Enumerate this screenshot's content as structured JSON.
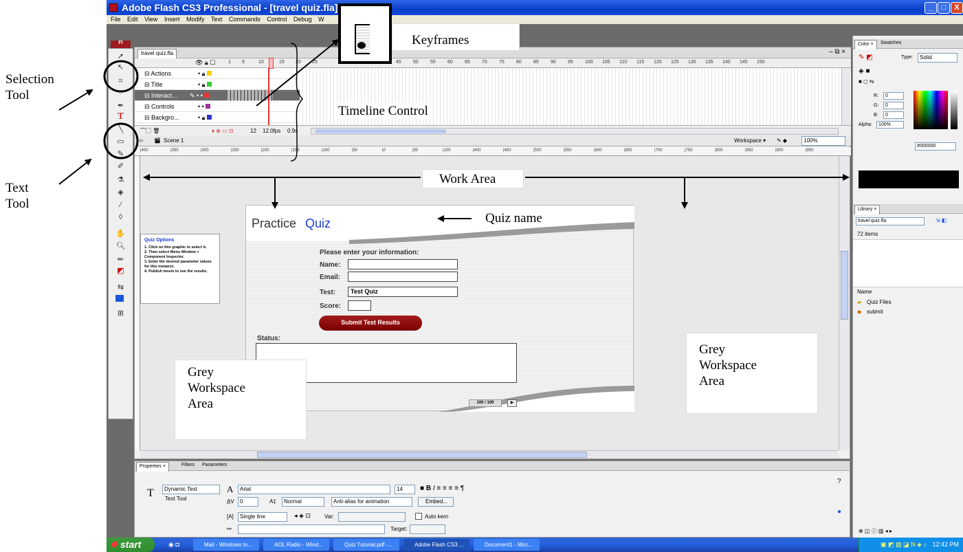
{
  "window": {
    "title": "Adobe Flash CS3 Professional - [travel quiz.fla]",
    "minimize": "_",
    "maximize": "□",
    "close": "X"
  },
  "menu": [
    "File",
    "Edit",
    "View",
    "Insert",
    "Modify",
    "Text",
    "Commands",
    "Control",
    "Debug",
    "W"
  ],
  "document": {
    "tab": "travel quiz.fla",
    "scene": "Scene 1",
    "workspace": "Workspace ▾",
    "zoom": "100%"
  },
  "timeline": {
    "frame_numbers": [
      "1",
      "5",
      "10",
      "15",
      "20",
      "25",
      "45",
      "50",
      "55",
      "60",
      "65",
      "70",
      "75",
      "80",
      "85",
      "90",
      "95",
      "100",
      "105",
      "110",
      "115",
      "120",
      "125",
      "130",
      "135",
      "140",
      "145",
      "150"
    ],
    "layers": [
      "Actions",
      "Title",
      "Interact...",
      "Controls",
      "Backgro..."
    ],
    "selected_layer": "Interact...",
    "current_frame": "12",
    "fps": "12.0fps",
    "time": "0.9s"
  },
  "ruler_ticks": [
    "|400",
    "|350",
    "|300",
    "|250",
    "|200",
    "|150",
    "|100",
    "|50",
    "|0",
    "|50",
    "|100",
    "|400",
    "|450",
    "|500",
    "|550",
    "|600",
    "|650",
    "|700",
    "|750",
    "|800",
    "|850",
    "|900",
    "|950"
  ],
  "quiz": {
    "title_part1": "Practice ",
    "title_part2": "Quiz",
    "prompt": "Please enter your information:",
    "name_label": "Name:",
    "email_label": "Email:",
    "test_label": "Test:",
    "test_value": "Test Quiz",
    "score_label": "Score:",
    "submit": "Submit Test Results",
    "status_label": "Status:",
    "counter": "100 / 100"
  },
  "quiz_options": {
    "title": "Quiz Options",
    "lines": [
      "1. Click on this graphic to select it.",
      "2. Then select Menu Window > Component Inspector.",
      "3. Enter the desired parameter values for this instance.",
      "4. Publish movie to see the results."
    ]
  },
  "properties": {
    "tabs": [
      "Properties ×",
      "Filters",
      "Parameters"
    ],
    "text_type": "Dynamic Text",
    "tool_name": "Text Tool",
    "font": "Arial",
    "size": "14",
    "letter_spacing": "0",
    "position": "Normal",
    "antialias": "Anti-alias for animation",
    "embed": "Embed...",
    "line_type": "Single line",
    "var_label": "Var:",
    "autokern": "Auto kern",
    "target_label": "Target:"
  },
  "color_panel": {
    "tabs": [
      "Color ×",
      "Swatches"
    ],
    "type_label": "Type:",
    "type_value": "Solid",
    "r_label": "R:",
    "r": "0",
    "g_label": "G:",
    "g": "0",
    "b_label": "B:",
    "b": "0",
    "alpha_label": "Alpha:",
    "alpha": "100%",
    "hex": "#000000"
  },
  "library": {
    "tab": "Library ×",
    "file": "travel quiz.fla",
    "count": "72 items",
    "header": "Name",
    "items": [
      "Quiz Files",
      "submit"
    ]
  },
  "taskbar": {
    "start": "start",
    "tasks": [
      "Mail - Windows In...",
      "AOL Radio - Wind...",
      "Quiz Tutorial.pdf -...",
      "Adobe Flash CS3 ...",
      "Document1 - Micr..."
    ],
    "time": "12:42 PM"
  },
  "annotations": {
    "selection_tool": [
      "Selection",
      "Tool"
    ],
    "text_tool": [
      "Text",
      "Tool"
    ],
    "keyframes": "Keyframes",
    "timeline_control": "Timeline Control",
    "work_area": "Work Area",
    "quiz_name": "Quiz name",
    "grey_left": [
      "Grey",
      "Workspace",
      "Area"
    ],
    "grey_right": [
      "Grey",
      "Workspace",
      "Area"
    ]
  },
  "colors": {
    "titlebar": "#0a3fc7",
    "workarea": "#e8e8e8",
    "quiz_accent": "#1a3fd6",
    "submit_button": "#8b0000",
    "annotation_outline": "#000000"
  }
}
